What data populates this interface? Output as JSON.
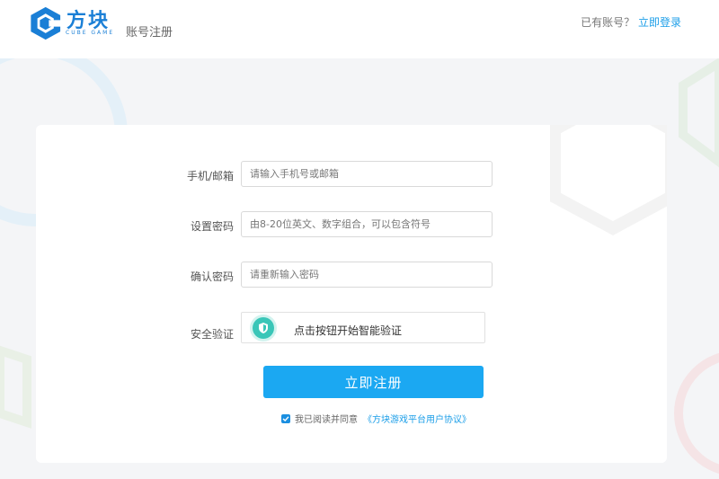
{
  "header": {
    "logo_text": "方块",
    "logo_sub": "CUBE GAME",
    "page_title": "账号注册",
    "login_prompt": "已有账号？",
    "login_link": "立即登录"
  },
  "form": {
    "account": {
      "label": "手机/邮箱",
      "placeholder": "请输入手机号或邮箱",
      "value": ""
    },
    "password": {
      "label": "设置密码",
      "placeholder": "由8-20位英文、数字组合，可以包含符号",
      "value": ""
    },
    "confirm": {
      "label": "确认密码",
      "placeholder": "请重新输入密码",
      "value": ""
    },
    "captcha": {
      "label": "安全验证",
      "text": "点击按钮开始智能验证"
    },
    "submit_label": "立即注册",
    "agree_text": "我已阅读并同意",
    "agree_link": "《方块游戏平台用户协议》",
    "agree_checked": true
  },
  "colors": {
    "brand": "#1a7fd6",
    "primary_button": "#1ba8f2",
    "link": "#1b9ee8",
    "captcha_icon": "#3ac6b8"
  }
}
